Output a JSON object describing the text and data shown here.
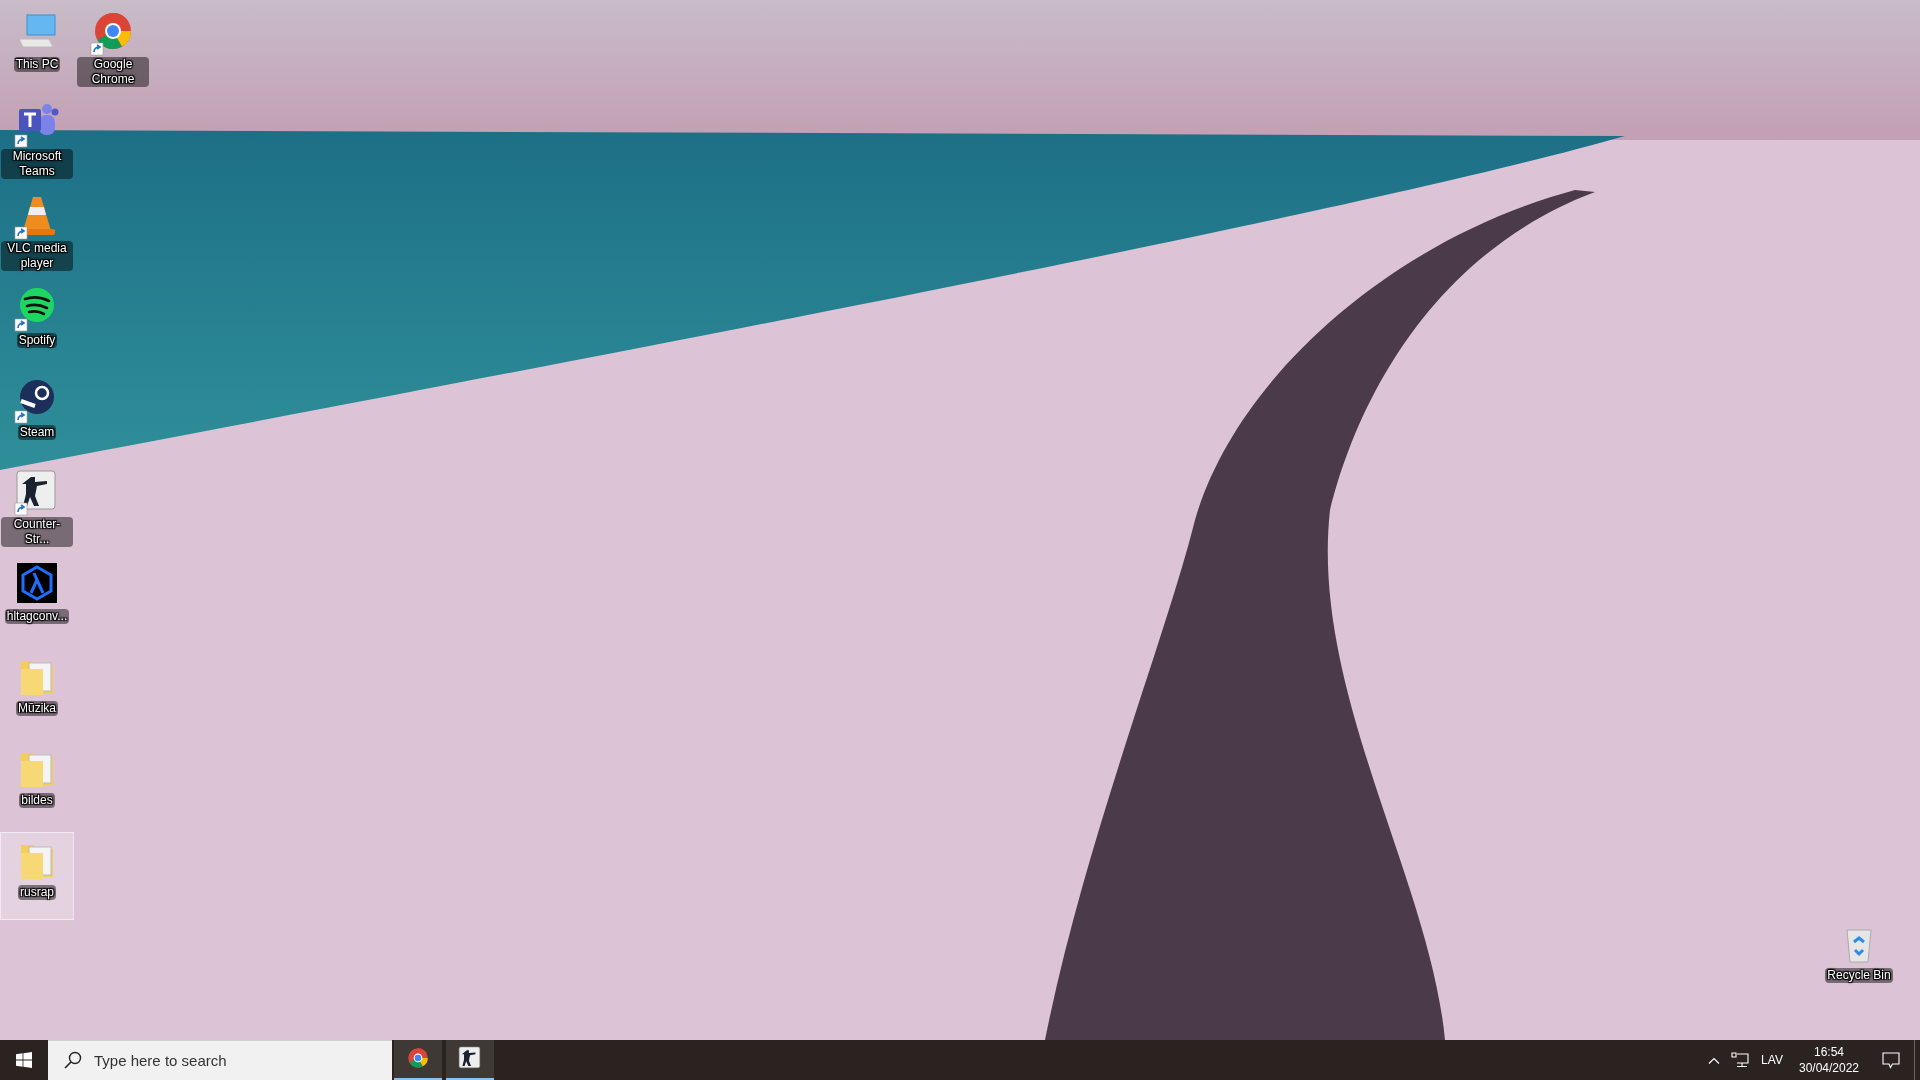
{
  "desktop": {
    "icon_columns": [
      [
        {
          "label": "This PC",
          "kind": "pc",
          "shortcut": false,
          "selected": false
        },
        {
          "label": "Microsoft Teams",
          "kind": "teams",
          "shortcut": true,
          "selected": false
        },
        {
          "label": "VLC media player",
          "kind": "vlc",
          "shortcut": true,
          "selected": false
        },
        {
          "label": "Spotify",
          "kind": "spotify",
          "shortcut": true,
          "selected": false
        },
        {
          "label": "Steam",
          "kind": "steam",
          "shortcut": true,
          "selected": false
        },
        {
          "label": "Counter-Str...",
          "kind": "cs",
          "shortcut": true,
          "selected": false
        },
        {
          "label": "hltagconv...",
          "kind": "hl",
          "shortcut": false,
          "selected": false
        },
        {
          "label": "Mūzika",
          "kind": "folder",
          "shortcut": false,
          "selected": false
        },
        {
          "label": "bildes",
          "kind": "folder",
          "shortcut": false,
          "selected": false
        },
        {
          "label": "rusrap",
          "kind": "folder",
          "shortcut": false,
          "selected": true
        }
      ],
      [
        {
          "label": "Google Chrome",
          "kind": "chrome",
          "shortcut": true,
          "selected": false
        }
      ]
    ],
    "recycle_bin": {
      "label": "Recycle Bin"
    }
  },
  "taskbar": {
    "search": {
      "placeholder": "Type here to search"
    },
    "apps": [
      {
        "kind": "chrome",
        "running": true
      },
      {
        "kind": "cs",
        "running": true
      }
    ],
    "tray": {
      "language": "LAV",
      "time": "16:54",
      "date": "30/04/2022"
    }
  }
}
